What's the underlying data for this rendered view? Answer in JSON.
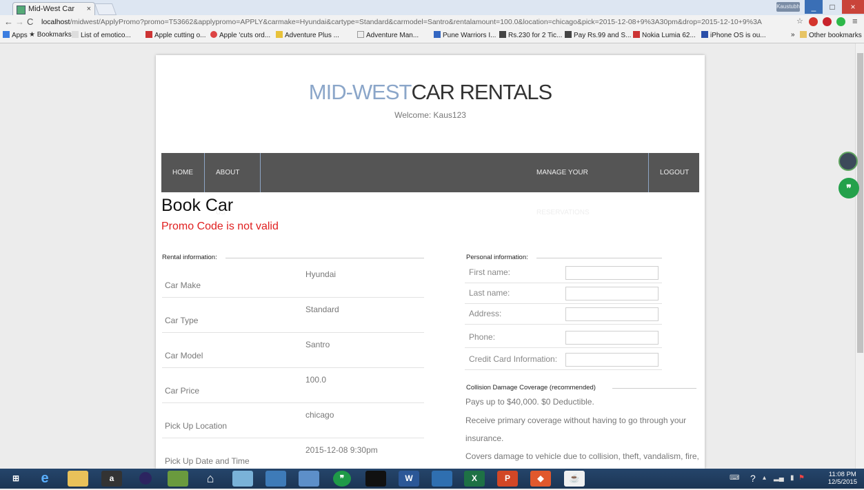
{
  "browser": {
    "tab_title": "Mid-West Car Rental",
    "tab_close": "×",
    "user_badge": "Kaustubh",
    "minimize": "_",
    "maximize": "□",
    "close": "×",
    "url_host": "localhost",
    "url_rest": "/midwest/ApplyPromo?promo=T53662&applypromo=APPLY&carmake=Hyundai&cartype=Standard&carmodel=Santro&rentalamount=100.0&location=chicago&pick=2015-12-08+9%3A30pm&drop=2015-12-10+9%3A",
    "bookmarks": [
      "Apps",
      "Bookmarks",
      "List of emotico...",
      "Apple cutting o...",
      "Apple 'cuts ord...",
      "Adventure Plus ...",
      "Adventure Man...",
      "Pune Warriors I...",
      "Rs.230 for 2 Tic...",
      "Pay Rs.99 and S...",
      "Nokia Lumia 62...",
      "iPhone OS is ou..."
    ],
    "other_bookmarks": "Other bookmarks",
    "more_bookmarks": "»"
  },
  "site": {
    "brand_accent": "MID-WEST",
    "brand_rest": "CAR RENTALS",
    "welcome": "Welcome: Kaus123",
    "nav": {
      "home": "HOME",
      "about": "ABOUT US",
      "manage": "MANAGE YOUR RESERVATIONS",
      "logout": "LOGOUT"
    },
    "heading": "Book Car",
    "promo_error": "Promo Code is not valid",
    "rental_section": "Rental information:",
    "rental_rows": [
      {
        "label": "Car Make",
        "value": "Hyundai"
      },
      {
        "label": "Car Type",
        "value": "Standard"
      },
      {
        "label": "Car Model",
        "value": "Santro"
      },
      {
        "label": "Car Price",
        "value": "100.0"
      },
      {
        "label": "Pick Up Location",
        "value": "chicago"
      },
      {
        "label": "Pick Up Date and Time",
        "value": "2015-12-08 9:30pm"
      }
    ],
    "personal_section": "Personal information:",
    "personal_fields": [
      "First name:",
      "Last name:",
      "Address:",
      "Phone:",
      "Credit Card Information:"
    ],
    "cdw_section": "Collision Damage Coverage (recommended)",
    "cdw_lines": [
      "Pays up to $40,000. $0 Deductible.",
      "Receive primary coverage without having to go through your",
      "insurance.",
      "Covers damage to vehicle due to collision, theft, vandalism, fire,"
    ]
  },
  "taskbar": {
    "time": "11:08 PM",
    "date": "12/5/2015"
  },
  "colors": {
    "accent": "#8ba6c9",
    "nav_bg": "#555555",
    "error": "#e02020"
  }
}
